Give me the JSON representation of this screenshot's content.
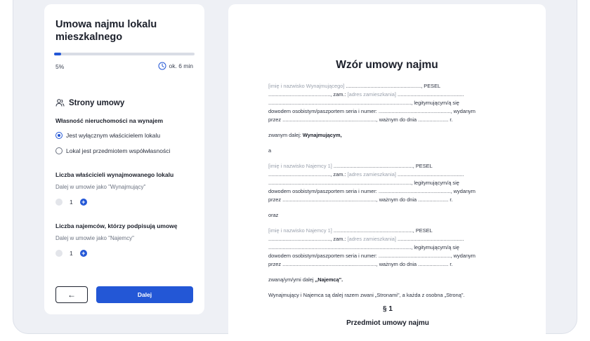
{
  "sidebar": {
    "title": "Umowa najmu lokalu mieszkalnego",
    "progress_percent": 5,
    "progress_label": "5%",
    "time_label": "ok. 6 min",
    "section_title": "Strony umowy",
    "ownership": {
      "label": "Własność nieruchomości na wynajem",
      "options": [
        "Jest wyłącznym właścicielem lokalu",
        "Lokal jest przedmiotem współwłasności"
      ],
      "selected_index": 0
    },
    "owners": {
      "label": "Liczba właścicieli wynajmowanego lokalu",
      "hint": "Dalej w umowie jako \"Wynajmujący\"",
      "value": "1"
    },
    "tenants": {
      "label": "Liczba najemców, którzy podpisują umowę",
      "hint": "Dalej w umowie jako \"Najemcy\"",
      "value": "1"
    },
    "next_label": "Dalej",
    "plus_glyph": "+",
    "back_glyph": "←"
  },
  "document": {
    "title": "Wzór umowy najmu",
    "landlord": {
      "ph_name": "[imię i nazwisko Wynajmującego]",
      "l1_rest": " ...................................................., PESEL",
      "l2_a": "..........................................., zam.: ",
      "ph_addr": "[adres zamieszkania]",
      "l2_b": " ..............................................",
      "l3": "..................................................................................................., legitymującym/ą się",
      "l4": "dowodem osobistym/paszportem seria i numer: .................................................., wydanym",
      "l5": "przez ................................................................., ważnym do dnia ..................... r.",
      "called_prefix": "zwanym dalej: ",
      "called_bold": "Wynajmującym,"
    },
    "conj_a": "a",
    "tenant1": {
      "ph_name": "[imię i nazwisko Najemcy 1]",
      "l1_rest": " ......................................................., PESEL",
      "l2_a": "..........................................., zam.: ",
      "ph_addr": "[adres zamieszkania]",
      "l2_b": " ..............................................",
      "l3": "..................................................................................................., legitymującym/ą się",
      "l4": "dowodem osobistym/paszportem seria i numer: .................................................., wydanym",
      "l5": "przez ................................................................., ważnym do dnia ..................... r."
    },
    "conj_oraz": "oraz",
    "tenant2": {
      "ph_name": "[imię i nazwisko Najemcy 1]",
      "l1_rest": " ......................................................., PESEL",
      "l2_a": "..........................................., zam.: ",
      "ph_addr": "[adres zamieszkania]",
      "l2_b": " ..............................................",
      "l3": "..................................................................................................., legitymującym/ą się",
      "l4": "dowodem osobistym/paszportem seria i numer: .................................................., wydanym",
      "l5": "przez ................................................................., ważnym do dnia ..................... r.",
      "called_prefix": "zwaną/ym/ymi dalej ",
      "called_bold": "„Najemcą\"."
    },
    "parties_sentence": "Wynajmujący i Najemca są dalej razem zwani „Stronami\", a każda z osobna „Stroną\".",
    "section_num": "§ 1",
    "section_title": "Przedmiot umowy najmu"
  }
}
